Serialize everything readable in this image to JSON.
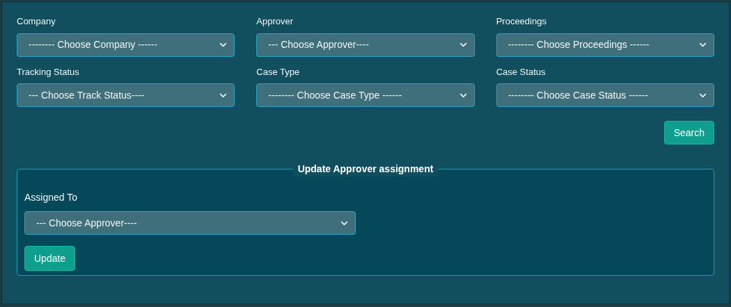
{
  "filters": [
    {
      "label": "Company",
      "value": "-------- Choose Company ------"
    },
    {
      "label": "Approver",
      "value": "--- Choose Approver----"
    },
    {
      "label": "Proceedings",
      "value": "-------- Choose Proceedings ------"
    },
    {
      "label": "Tracking Status",
      "value": "--- Choose Track Status----"
    },
    {
      "label": "Case Type",
      "value": "-------- Choose Case Type ------"
    },
    {
      "label": "Case Status",
      "value": "-------- Choose Case Status ------"
    }
  ],
  "search_button": "Search",
  "assignment": {
    "legend": "Update Approver assignment",
    "label": "Assigned To",
    "value": "--- Choose Approver----",
    "button": "Update"
  }
}
